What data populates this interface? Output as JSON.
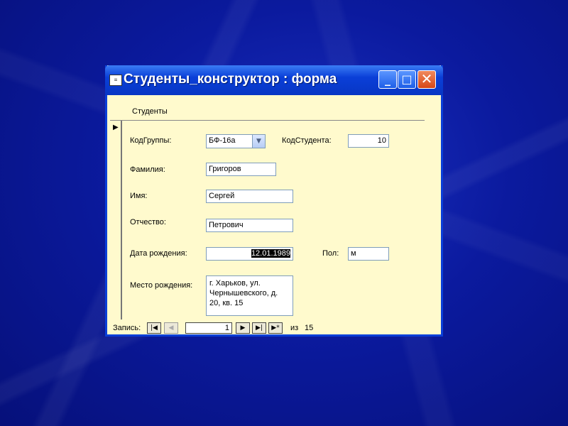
{
  "window": {
    "title": "Студенты_конструктор : форма",
    "icon_name": "form-icon",
    "controls": {
      "minimize": "_",
      "maximize": "□",
      "close": "✕"
    }
  },
  "form": {
    "section_label": "Студенты",
    "fields": {
      "group_code": {
        "label": "КодГруппы:",
        "value": "БФ-16а"
      },
      "student_code": {
        "label": "КодСтудента:",
        "value": "10"
      },
      "surname": {
        "label": "Фамилия:",
        "value": "Григоров"
      },
      "name": {
        "label": "Имя:",
        "value": "Сергей"
      },
      "patronymic": {
        "label": "Отчество:",
        "value": "Петрович"
      },
      "birth_date": {
        "label": "Дата рождения:",
        "value": "12.01.1989"
      },
      "gender": {
        "label": "Пол:",
        "value": "м"
      },
      "birth_place": {
        "label": "Место рождения:",
        "value": "г. Харьков, ул. Чернышевского, д. 20, кв. 15"
      }
    }
  },
  "navigation": {
    "label": "Запись:",
    "current": "1",
    "of_label": "из",
    "total": "15",
    "buttons": {
      "first": "|◀",
      "prev": "◀",
      "next": "▶",
      "last": "▶|",
      "new": "▶*"
    }
  },
  "colors": {
    "form_bg": "#fffacd",
    "titlebar": "#0a3fd8",
    "desktop": "#0b1a9e"
  }
}
